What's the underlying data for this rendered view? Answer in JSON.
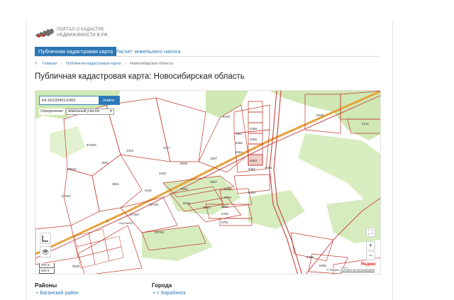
{
  "header": {
    "logo_text_line1": "ПОРТАЛ О КАДАСТРЕ",
    "logo_text_line2": "НЕДВИЖИМОСТИ В РФ"
  },
  "tabs": [
    {
      "label": "Публичная кадастровая карта",
      "active": true
    },
    {
      "label": "Расчет земельного налога",
      "active": false
    }
  ],
  "breadcrumb": [
    "Главная",
    "Публичная кадастровая карта",
    "Новосибирская область"
  ],
  "page_title": "Публичная кадастровая карта: Новосибирская область",
  "map": {
    "search_value": "54:18:020401:6459",
    "search_button": "Найти",
    "definition_label": "Определение",
    "definition_select": "земельный участок",
    "zoom_in": "+",
    "zoom_out": "−",
    "fullscreen": "⛶",
    "scale_top": "200 m",
    "scale_bottom": "500 ft",
    "provider": "Яндекс",
    "footer_copy": "© Яндекс",
    "footer_link": "Условия использования",
    "parcel_labels": [
      "4140",
      "5732/5",
      "3831",
      "3402",
      "3177",
      "2784/4",
      "3831",
      "2784/4",
      "3440",
      "8535",
      "3307",
      "3442",
      "8064",
      "3307",
      "6454",
      "6461",
      "6462",
      "6463",
      "6464",
      "6465",
      "6466",
      "6467",
      "6468",
      "2539",
      "4141",
      "1",
      "3979/1",
      "9034",
      "9033",
      "6785",
      "6784",
      "6783",
      "6782",
      "6781",
      "3979/2",
      "9038",
      "6485",
      "6486",
      "6487",
      "4179/2"
    ],
    "place_label": "Кирзавод"
  },
  "lists": {
    "regions_heading": "Районы",
    "regions_first": "Баганский район",
    "cities_heading": "Города",
    "cities_first": "г. Барабинск"
  }
}
